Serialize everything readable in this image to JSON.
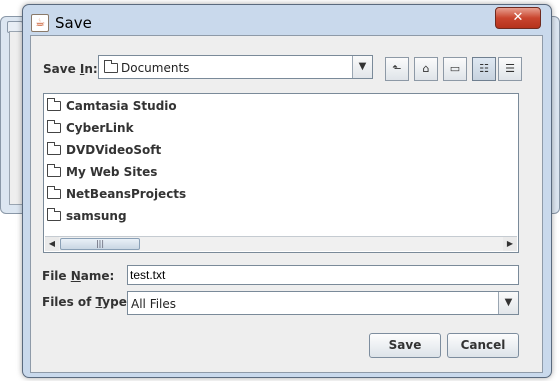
{
  "dialog": {
    "title": "Save",
    "app_icon": "java-icon",
    "close_symbol": "✕"
  },
  "save_in": {
    "label_pre": "Save ",
    "label_mnemonic": "I",
    "label_post": "n:",
    "value": "Documents"
  },
  "toolbar": {
    "buttons": [
      "up-one-level-icon",
      "home-icon",
      "new-folder-icon",
      "list-view-icon",
      "details-view-icon"
    ],
    "active": "list-view-icon"
  },
  "files": [
    {
      "name": "Camtasia Studio"
    },
    {
      "name": "CyberLink"
    },
    {
      "name": "DVDVideoSoft"
    },
    {
      "name": "My Web Sites"
    },
    {
      "name": "NetBeansProjects"
    },
    {
      "name": "samsung"
    }
  ],
  "file_name": {
    "label_pre": "File ",
    "label_mnemonic": "N",
    "label_post": "ame:",
    "value": "test.txt"
  },
  "file_type": {
    "label_pre": "Files of ",
    "label_mnemonic": "T",
    "label_post": "ype:",
    "value": "All Files"
  },
  "buttons": {
    "save": "Save",
    "cancel": "Cancel"
  }
}
